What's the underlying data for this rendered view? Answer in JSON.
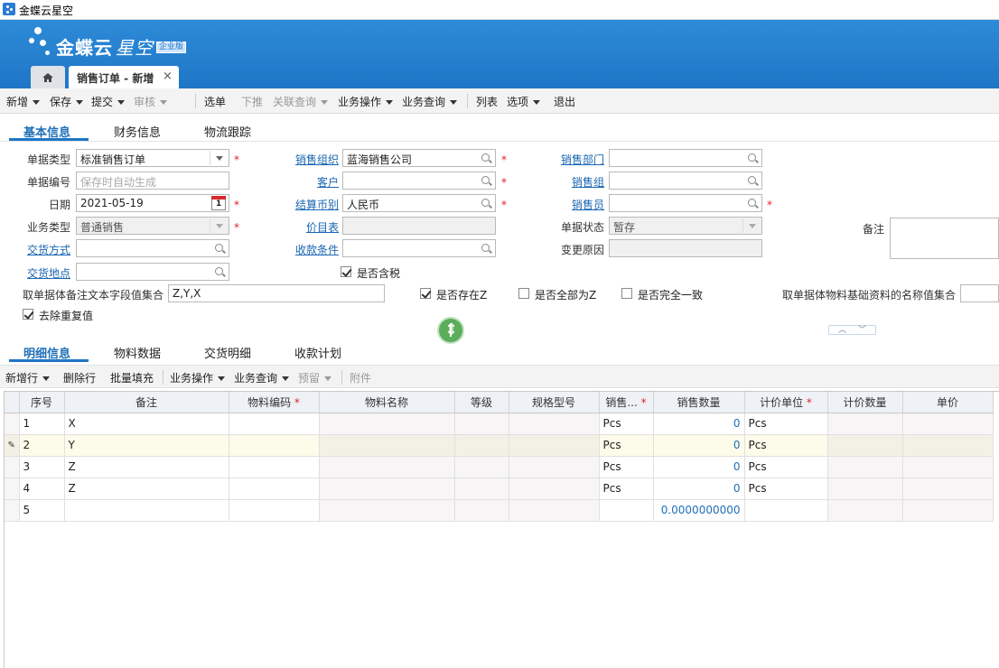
{
  "window": {
    "title": "金蝶云星空"
  },
  "brand": {
    "name1": "金蝶云",
    "name2": "星空",
    "edition": "企业版"
  },
  "tabs": {
    "home_icon": "home-icon",
    "doc_tab_label": "销售订单 - 新增",
    "close_glyph": "×"
  },
  "toolbar": {
    "items": [
      {
        "label": "新增",
        "dropdown": true,
        "disabled": false
      },
      {
        "label": "保存",
        "dropdown": true,
        "disabled": false
      },
      {
        "label": "提交",
        "dropdown": true,
        "disabled": false
      },
      {
        "label": "审核",
        "dropdown": true,
        "disabled": true
      },
      {
        "label": "选单",
        "dropdown": false,
        "disabled": false
      },
      {
        "label": "下推",
        "dropdown": false,
        "disabled": true
      },
      {
        "label": "关联查询",
        "dropdown": true,
        "disabled": true
      },
      {
        "label": "业务操作",
        "dropdown": true,
        "disabled": false
      },
      {
        "label": "业务查询",
        "dropdown": true,
        "disabled": false
      },
      {
        "label": "列表",
        "dropdown": false,
        "disabled": false
      },
      {
        "label": "选项",
        "dropdown": true,
        "disabled": false
      },
      {
        "label": "退出",
        "dropdown": false,
        "disabled": false
      }
    ]
  },
  "header_tabs": [
    "基本信息",
    "财务信息",
    "物流跟踪"
  ],
  "form": {
    "bill_type": {
      "label": "单据类型",
      "value": "标准销售订单"
    },
    "bill_no": {
      "label": "单据编号",
      "placeholder": "保存时自动生成"
    },
    "date": {
      "label": "日期",
      "value": "2021-05-19",
      "cal_day": "1"
    },
    "biz_type": {
      "label": "业务类型",
      "value": "普通销售"
    },
    "delivery_method": {
      "label": "交货方式",
      "value": ""
    },
    "delivery_place": {
      "label": "交货地点",
      "value": ""
    },
    "sale_org": {
      "label": "销售组织",
      "value": "蓝海销售公司"
    },
    "customer": {
      "label": "客户",
      "value": ""
    },
    "settle_currency": {
      "label": "结算币别",
      "value": "人民币"
    },
    "price_list": {
      "label": "价目表",
      "value": ""
    },
    "receipt_condition": {
      "label": "收款条件",
      "value": ""
    },
    "sale_dept": {
      "label": "销售部门",
      "value": ""
    },
    "sale_group": {
      "label": "销售组",
      "value": ""
    },
    "salesman": {
      "label": "销售员",
      "value": ""
    },
    "bill_status": {
      "label": "单据状态",
      "value": "暂存"
    },
    "change_reason": {
      "label": "变更原因",
      "value": ""
    },
    "remarks": {
      "label": "备注",
      "value": ""
    },
    "tax_included": {
      "label": "是否含税",
      "checked": true
    },
    "remark_field_set": {
      "label": "取单据体备注文本字段值集合",
      "value": "Z,Y,X"
    },
    "exists_z": {
      "label": "是否存在Z",
      "checked": true
    },
    "all_z": {
      "label": "是否全部为Z",
      "checked": false
    },
    "all_same": {
      "label": "是否完全一致",
      "checked": false
    },
    "material_name_set": {
      "label": "取单据体物料基础资料的名称值集合",
      "value": ""
    },
    "dedupe": {
      "label": "去除重复值",
      "checked": true
    }
  },
  "entry_tabs": [
    "明细信息",
    "物料数据",
    "交货明细",
    "收款计划"
  ],
  "entry_toolbar": {
    "items": [
      {
        "label": "新增行",
        "dropdown": true,
        "disabled": false
      },
      {
        "label": "删除行",
        "dropdown": false,
        "disabled": false
      },
      {
        "label": "批量填充",
        "dropdown": false,
        "disabled": false
      },
      {
        "label": "业务操作",
        "dropdown": true,
        "disabled": false
      },
      {
        "label": "业务查询",
        "dropdown": true,
        "disabled": false
      },
      {
        "label": "预留",
        "dropdown": true,
        "disabled": true
      },
      {
        "label": "附件",
        "dropdown": false,
        "disabled": true
      }
    ]
  },
  "grid": {
    "columns": [
      {
        "label": "",
        "required": false
      },
      {
        "label": "序号",
        "required": false
      },
      {
        "label": "备注",
        "required": false
      },
      {
        "label": "物料编码",
        "required": true
      },
      {
        "label": "物料名称",
        "required": false
      },
      {
        "label": "等级",
        "required": false
      },
      {
        "label": "规格型号",
        "required": false
      },
      {
        "label": "销售...",
        "required": true
      },
      {
        "label": "销售数量",
        "required": false
      },
      {
        "label": "计价单位",
        "required": true
      },
      {
        "label": "计价数量",
        "required": false
      },
      {
        "label": "单价",
        "required": false
      }
    ],
    "rows": [
      {
        "mark": "",
        "seq": "1",
        "remark": "X",
        "unit": "Pcs",
        "qty": "0",
        "price_unit": "Pcs"
      },
      {
        "mark": "✎",
        "seq": "2",
        "remark": "Y",
        "unit": "Pcs",
        "qty": "0",
        "price_unit": "Pcs"
      },
      {
        "mark": "",
        "seq": "3",
        "remark": "Z",
        "unit": "Pcs",
        "qty": "0",
        "price_unit": "Pcs"
      },
      {
        "mark": "",
        "seq": "4",
        "remark": "Z",
        "unit": "Pcs",
        "qty": "0",
        "price_unit": "Pcs"
      },
      {
        "mark": "",
        "seq": "5",
        "remark": "",
        "unit": "",
        "qty": "",
        "price_unit": ""
      }
    ],
    "total_qty": "0.0000000000"
  },
  "colors": {
    "accent": "#1f76c6",
    "link": "#1a66b2",
    "required": "#e0202a"
  }
}
